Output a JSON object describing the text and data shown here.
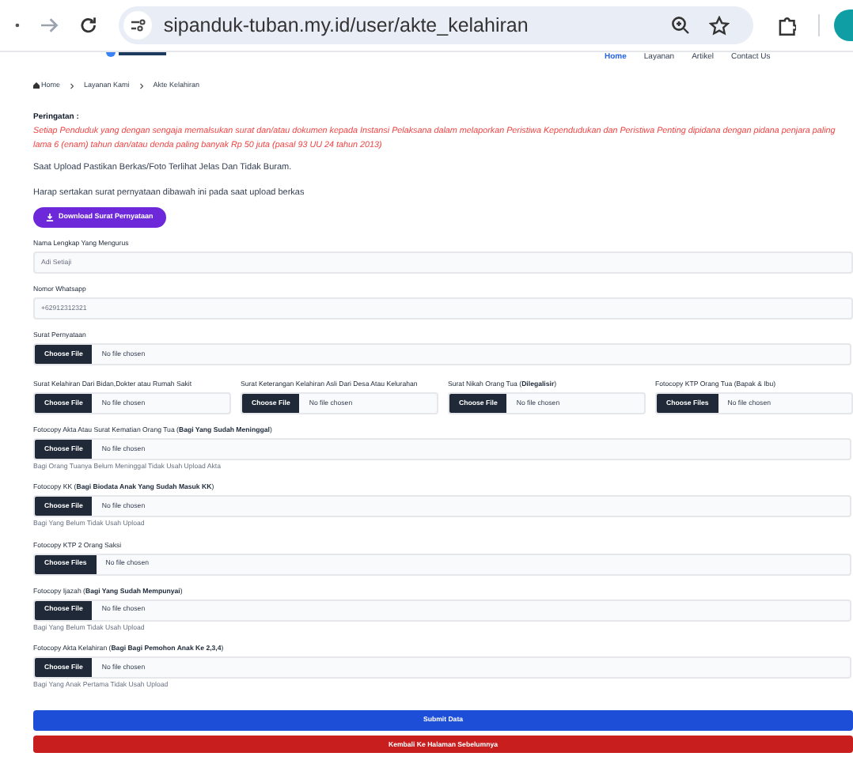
{
  "browser": {
    "url": "sipanduk-tuban.my.id/user/akte_kelahiran"
  },
  "nav": {
    "links": [
      {
        "label": "Home",
        "selected": true
      },
      {
        "label": "Layanan",
        "selected": false
      },
      {
        "label": "Artikel",
        "selected": false
      },
      {
        "label": "Contact Us",
        "selected": false
      }
    ]
  },
  "breadcrumb": [
    "Home",
    "Layanan Kami",
    "Akte Kelahiran"
  ],
  "warning": {
    "title": "Peringatan :",
    "text": "Setiap Penduduk yang dengan sengaja memalsukan surat dan/atau dokumen kepada Instansi Pelaksana dalam melaporkan Peristiwa Kependudukan dan Peristiwa Penting dipidana dengan pidana penjara paling lama 6 (enam) tahun dan/atau denda paling banyak Rp 50 juta (pasal 93 UU 24 tahun 2013)"
  },
  "notes": [
    "Saat Upload Pastikan Berkas/Foto Terlihat Jelas Dan Tidak Buram.",
    "Harap sertakan surat pernyataan dibawah ini pada saat upload berkas"
  ],
  "download_button": "Download Surat Pernyataan",
  "fields": [
    {
      "kind": "text",
      "label": "Nama Lengkap Yang Mengurus",
      "value": "Adi Setiaji"
    },
    {
      "kind": "text",
      "label": "Nomor Whatsapp",
      "value": "+62912312321"
    },
    {
      "kind": "file",
      "label": "Surat Pernyataan",
      "button": "Choose File",
      "status": "No file chosen"
    },
    {
      "kind": "grid",
      "items": [
        {
          "label": "Surat Kelahiran Dari Bidan,Dokter atau Rumah Sakit",
          "button": "Choose File",
          "status": "No file chosen"
        },
        {
          "label": "Surat Keterangan Kelahiran Asli Dari Desa Atau Kelurahan",
          "button": "Choose File",
          "status": "No file chosen"
        },
        {
          "label": "Surat Nikah Orang Tua (**Dilegalisir**)",
          "button": "Choose File",
          "status": "No file chosen"
        },
        {
          "label": "Fotocopy KTP Orang Tua (Bapak & Ibu)",
          "button": "Choose Files",
          "status": "No file chosen"
        }
      ]
    },
    {
      "kind": "file",
      "label": "Fotocopy Akta Atau Surat Kematian Orang Tua (**Bagi Yang Sudah Meninggal**)",
      "button": "Choose File",
      "status": "No file chosen",
      "hint": "Bagi Orang Tuanya Belum Meninggal Tidak Usah Upload Akta"
    },
    {
      "kind": "file",
      "label": "Fotocopy KK (**Bagi Biodata Anak Yang Sudah Masuk KK**)",
      "button": "Choose File",
      "status": "No file chosen",
      "hint": "Bagi Yang Belum Tidak Usah Upload"
    },
    {
      "kind": "file",
      "label": "Fotocopy KTP 2 Orang Saksi",
      "button": "Choose Files",
      "status": "No file chosen"
    },
    {
      "kind": "file",
      "label": "Fotocopy Ijazah (**Bagi Yang Sudah Mempunyai**)",
      "button": "Choose File",
      "status": "No file chosen",
      "hint": "Bagi Yang Belum Tidak Usah Upload"
    },
    {
      "kind": "file",
      "label": "Fotocopy Akta Kelahiran (**Bagi Bagi Pemohon Anak Ke 2,3,4**)",
      "button": "Choose File",
      "status": "No file chosen",
      "hint": "Bagi Yang Anak Pertama Tidak Usah Upload"
    }
  ],
  "actions": [
    {
      "kind": "primary",
      "label": "Submit Data"
    },
    {
      "kind": "danger",
      "label": "Kembali Ke Halaman Sebelumnya"
    }
  ]
}
